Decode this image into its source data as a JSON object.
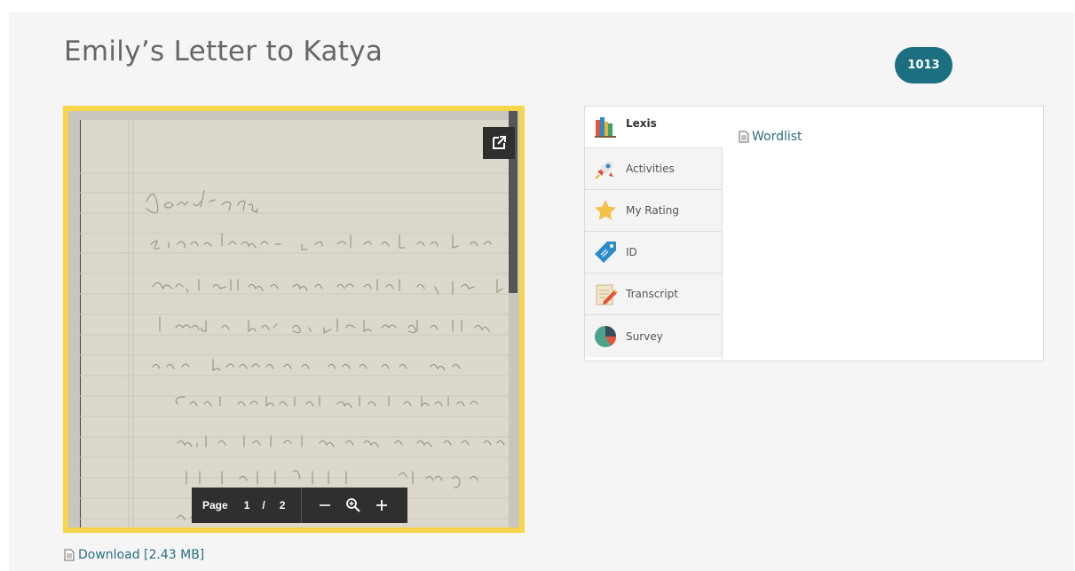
{
  "page": {
    "title": "Emily’s Letter to Katya",
    "badge": "1013"
  },
  "viewer": {
    "toolbar": {
      "page_label": "Page",
      "current_page": "1",
      "separator": "/",
      "total_pages": "2"
    },
    "popout_icon": "external-link-icon",
    "zoom_out_icon": "minus-icon",
    "zoom_icon": "magnifier-icon",
    "zoom_in_icon": "plus-icon"
  },
  "download": {
    "label": "Download [2.43 MB]",
    "icon": "document-icon"
  },
  "tabs": [
    {
      "label": "Lexis",
      "icon": "books-icon",
      "active": true
    },
    {
      "label": "Activities",
      "icon": "rocket-icon",
      "active": false
    },
    {
      "label": "My Rating",
      "icon": "star-icon",
      "active": false
    },
    {
      "label": "ID",
      "icon": "tag-icon",
      "active": false
    },
    {
      "label": "Transcript",
      "icon": "pencil-note-icon",
      "active": false
    },
    {
      "label": "Survey",
      "icon": "pie-chart-icon",
      "active": false
    }
  ],
  "tab_content": {
    "link": "Wordlist",
    "icon": "document-icon"
  },
  "colors": {
    "accent": "#1b6f80",
    "viewer_border": "#f7d54c",
    "link": "#2a6f82"
  }
}
